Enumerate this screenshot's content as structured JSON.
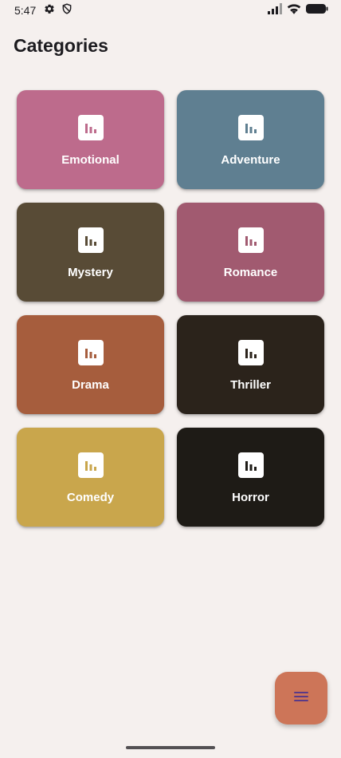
{
  "status_bar": {
    "time": "5:47",
    "left_icons": [
      "gear-icon",
      "shield-icon"
    ],
    "right_icons": [
      "signal-icon",
      "wifi-icon",
      "battery-icon"
    ]
  },
  "header": {
    "title": "Categories"
  },
  "categories": [
    {
      "label": "Emotional",
      "color": "#bd6b8c",
      "icon": "bar-chart-icon"
    },
    {
      "label": "Adventure",
      "color": "#5f7f91",
      "icon": "bar-chart-icon"
    },
    {
      "label": "Mystery",
      "color": "#584b36",
      "icon": "bar-chart-icon"
    },
    {
      "label": "Romance",
      "color": "#a15a70",
      "icon": "bar-chart-icon"
    },
    {
      "label": "Drama",
      "color": "#a65d3d",
      "icon": "bar-chart-icon"
    },
    {
      "label": "Thriller",
      "color": "#2b231b",
      "icon": "bar-chart-icon"
    },
    {
      "label": "Comedy",
      "color": "#c9a64c",
      "icon": "bar-chart-icon"
    },
    {
      "label": "Horror",
      "color": "#1e1b16",
      "icon": "bar-chart-icon"
    }
  ],
  "fab": {
    "icon": "menu-icon",
    "color": "#cd7558",
    "icon_color": "#5a3a88"
  }
}
